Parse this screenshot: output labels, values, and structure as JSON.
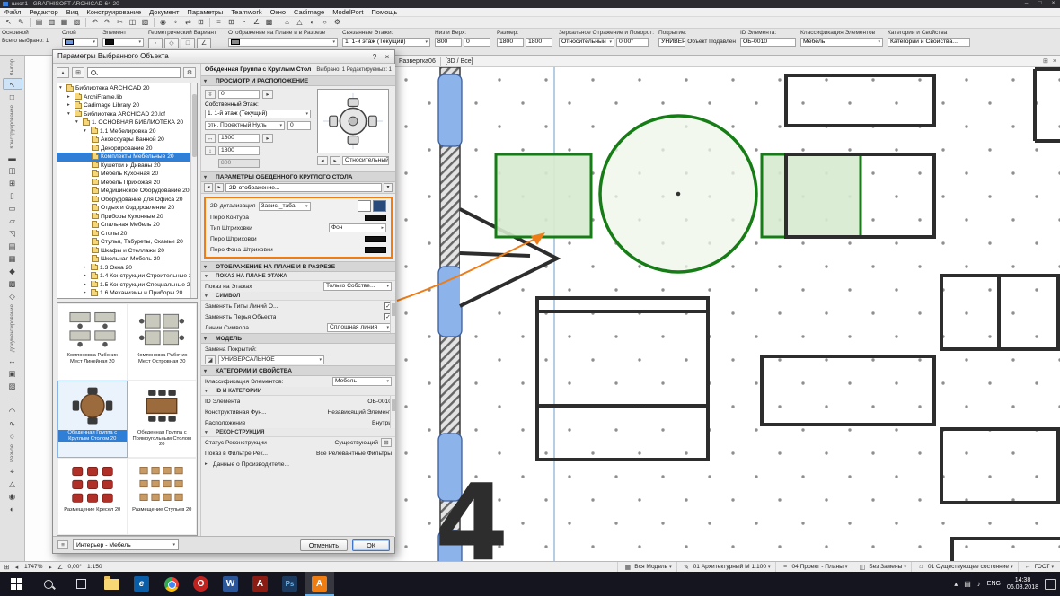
{
  "titlebar": {
    "title": "шкст1 - GRAPHISOFT ARCHICAD-64 20",
    "minimize": "–",
    "maximize": "□",
    "close": "×"
  },
  "menubar": {
    "items": [
      "Файл",
      "Редактор",
      "Вид",
      "Конструирование",
      "Документ",
      "Параметры",
      "Teamwork",
      "Окно",
      "Cadimage",
      "ModelPort",
      "Помощь"
    ]
  },
  "infobar": {
    "primary": {
      "label": "Основной",
      "info": "Всего выбрано: 1"
    },
    "layer": {
      "label": "Слой"
    },
    "element": {
      "label": "Элемент"
    },
    "geometry": {
      "label": "Геометрический Вариант"
    },
    "plan_display": {
      "label": "Отображение на Плане и в Разрезе"
    },
    "stories": {
      "label": "Связанные Этажи:",
      "value": "1. 1-й этаж (Текущий)"
    },
    "bottom_top": {
      "label": "Низ и Верх:",
      "v1": "800",
      "v2": "0"
    },
    "size": {
      "label": "Размер:",
      "v1": "1800",
      "v2": "1800"
    },
    "mirror": {
      "label": "Зеркальное Отражение и Поворот:",
      "v1": "Относительный",
      "v2": "0,00°"
    },
    "surface": {
      "label": "Покрытие:",
      "v1": "УНИВЕР...",
      "v2": "Объект Подавлен"
    },
    "element_id": {
      "label": "ID Элемента:",
      "value": "ОБ-0010"
    },
    "classification": {
      "label": "Классификация Элементов",
      "value": "Мебель"
    },
    "categories": {
      "label": "Категории и Свойства",
      "value": "Категории и Свойства..."
    }
  },
  "toolbox": {
    "sections": [
      {
        "label": "Выбор"
      },
      {
        "label": "Конструирование"
      },
      {
        "label": "Документирование"
      },
      {
        "label": "Разное"
      }
    ]
  },
  "canvas": {
    "tab": "Развертка06",
    "mode": "[3D / Все]",
    "axis_label": "4"
  },
  "dialog": {
    "title": "Параметры Выбранного Объекта",
    "help_label": "?",
    "close_label": "×",
    "object_name": "Обеденная Группа с Круглым Стол",
    "selected_info": "Выбрано: 1 Редактируемых: 1",
    "search": {
      "placeholder": ""
    },
    "tree": [
      {
        "label": "Библиотека ARCHICAD 20"
      },
      {
        "label": "ArchiFrame.lib"
      },
      {
        "label": "Cadimage Library 20"
      },
      {
        "label": "Библиотека ARCHICAD 20.lcf"
      },
      {
        "label": "1. ОСНОВНАЯ БИБЛИОТЕКА 20"
      },
      {
        "label": "1.1 Мебелировка 20"
      },
      {
        "label": "Аксессуары Ванной 20"
      },
      {
        "label": "Декорирование 20"
      },
      {
        "label": "Комплекты Мебельные 20",
        "selected": true
      },
      {
        "label": "Кушетки и Диваны 20"
      },
      {
        "label": "Мебель Кухонная 20"
      },
      {
        "label": "Мебель Прихожая 20"
      },
      {
        "label": "Медицинское Оборудование 20"
      },
      {
        "label": "Оборудование для Офиса 20"
      },
      {
        "label": "Отдых и Оздоровление 20"
      },
      {
        "label": "Приборы Кухонные 20"
      },
      {
        "label": "Спальная Мебель 20"
      },
      {
        "label": "Столы 20"
      },
      {
        "label": "Стулья, Табуреты, Скамьи 20"
      },
      {
        "label": "Шкафы и Стеллажи 20"
      },
      {
        "label": "Школьная Мебель 20"
      },
      {
        "label": "1.3 Окна 20"
      },
      {
        "label": "1.4 Конструкции Строительные 20"
      },
      {
        "label": "1.5 Конструкции Специальные 20"
      },
      {
        "label": "1.6 Механизмы и Приборы 20"
      }
    ],
    "thumbnails": [
      {
        "label": "Компоновка Рабочих Мест Линейная 20"
      },
      {
        "label": "Компоновка Рабочих Мест Островная 20"
      },
      {
        "label": "Обеденная Группа с Круглым Столом 20",
        "selected": true
      },
      {
        "label": "Обеденная Группа с Прямоугольным Столом 20"
      },
      {
        "label": "Размещение Кресел 20"
      },
      {
        "label": "Размещение Стульев 20"
      }
    ],
    "preview_section": {
      "title": "ПРОСМОТР И РАСПОЛОЖЕНИЕ",
      "elevation": "0",
      "story_label": "Собственный Этаж:",
      "story_value": "1. 1-й этаж (Текущий)",
      "datum_label": "отн. Проектный Нуль",
      "datum_value": "0",
      "dim_a": "1800",
      "dim_b": "1800",
      "dim_c": "800",
      "relative_label": "Относительный"
    },
    "params_section": {
      "title": "ПАРАМЕТРЫ ОБЕДЕННОГО КРУГЛОГО СТОЛА",
      "tab": "2D-отображение...",
      "detail_label": "2D-детализация",
      "detail_value": "Завис._таба",
      "rows": [
        {
          "label": "Перо Контура"
        },
        {
          "label": "Тип Штриховки",
          "value": "Фон"
        },
        {
          "label": "Перо Штриховки"
        },
        {
          "label": "Перо Фона Штриховки"
        }
      ]
    },
    "display_section": {
      "title": "ОТОБРАЖЕНИЕ НА ПЛАНЕ И В РАЗРЕЗЕ",
      "sub1": "ПОКАЗ НА ПЛАНЕ ЭТАЖА",
      "row_show_label": "Показ на Этажах",
      "row_show_value": "Только Собстве...",
      "sub2": "СИМВОЛ",
      "rows": [
        {
          "label": "Заменять Типы Линий О...",
          "check": "✓"
        },
        {
          "label": "Заменять Перья Объекта",
          "check": "✓"
        },
        {
          "label": "Линии Символа",
          "value": "Сплошная линия"
        }
      ]
    },
    "model_section": {
      "title": "МОДЕЛЬ",
      "label": "Замена Покрытий:",
      "value": "УНИВЕРСАЛЬНОЕ"
    },
    "categories_section": {
      "title": "КАТЕГОРИИ И СВОЙСТВА",
      "class_label": "Классификация Элементов:",
      "class_value": "Мебель",
      "sub_id": "ID И КАТЕГОРИИ",
      "rows_id": [
        {
          "label": "ID Элемента",
          "value": "ОБ-0010"
        },
        {
          "label": "Конструктивная Фун...",
          "value": "Независящий Элемент"
        },
        {
          "label": "Расположение",
          "value": "Внутри"
        }
      ],
      "sub_reno": "РЕКОНСТРУКЦИЯ",
      "rows_reno": [
        {
          "label": "Статус Реконструкции",
          "value": "Существующий"
        },
        {
          "label": "Показ в Фильтре Рек...",
          "value": "Все Релевантные Фильтры"
        }
      ],
      "manufacturer": "Данные о Производителе..."
    },
    "footer": {
      "layer": "Интерьер - Мебель",
      "cancel": "Отменить",
      "ok": "ОК"
    }
  },
  "statusbar": {
    "zoom": "1747%",
    "rotation": "0,00°",
    "scale": "1:150",
    "segments": [
      "Вся Модель",
      "01 Архитектурный М 1:100",
      "04 Проект - Планы",
      "Без Замены",
      "01 Существующее состояние",
      "ГОСТ"
    ]
  },
  "taskbar": {
    "language": "ENG",
    "time": "14:38",
    "date": "06.08.2018"
  },
  "colors": {
    "accent_orange": "#f07d12",
    "selection_blue": "#2f7fd6",
    "green_stroke": "#167d16",
    "green_fill": "#d7ead0",
    "wall_blue": "#8cb4ea",
    "plan_black": "#2d2d2d"
  }
}
